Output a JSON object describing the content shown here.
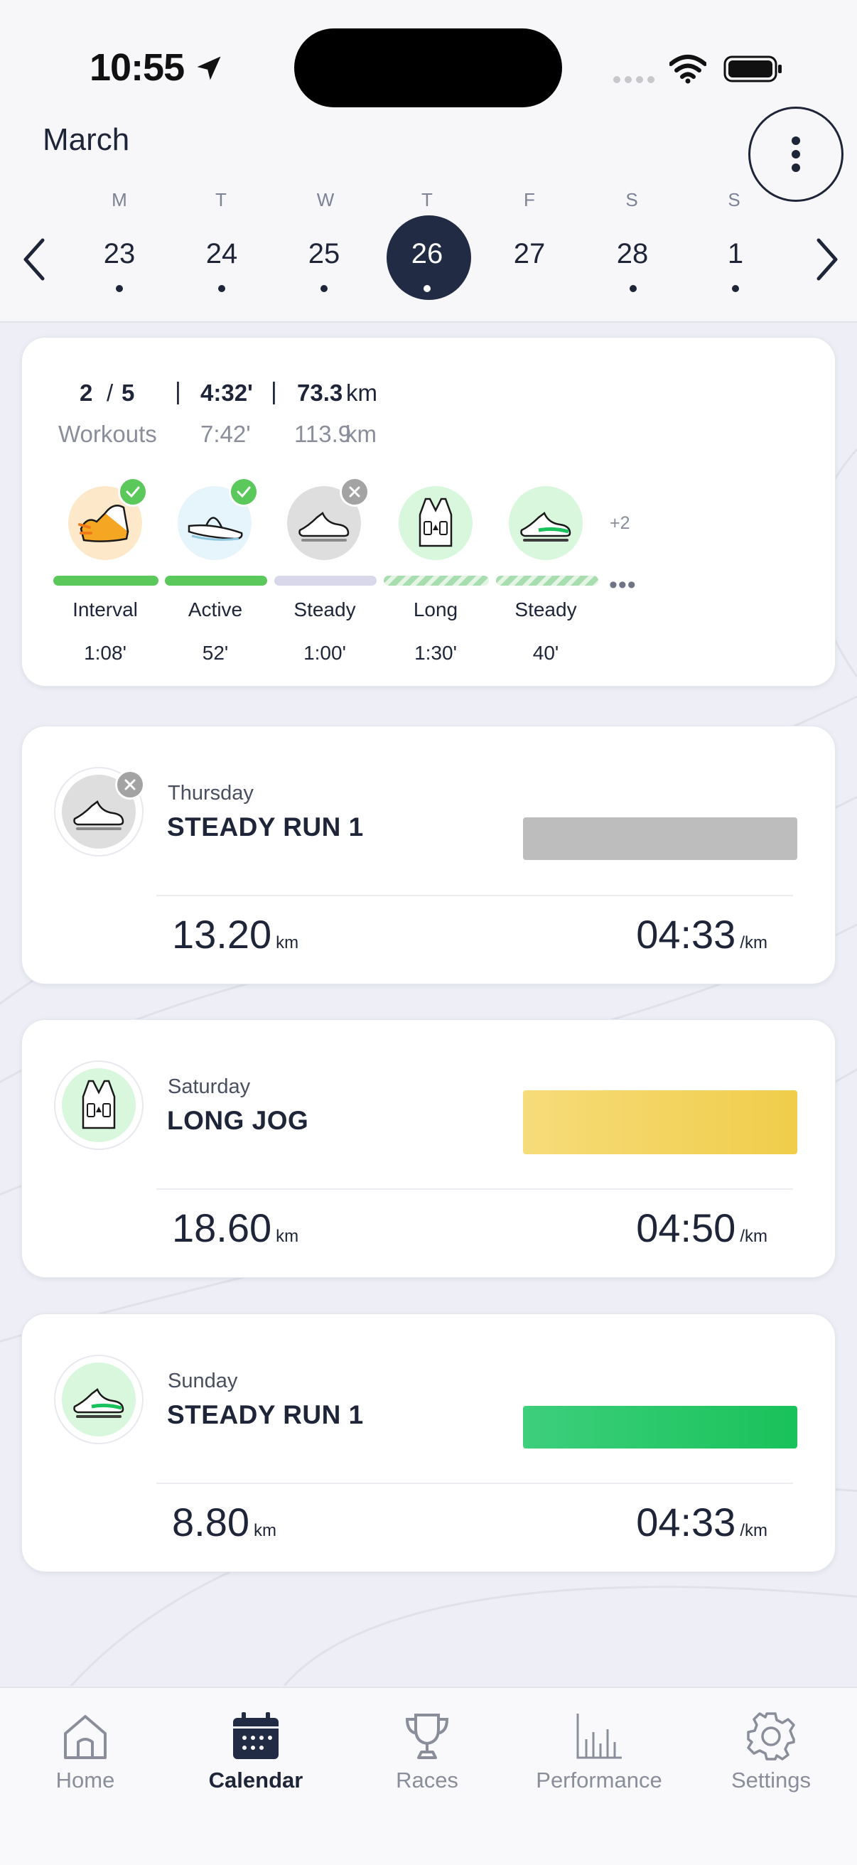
{
  "status_bar": {
    "time": "10:55"
  },
  "header": {
    "month": "March",
    "week": [
      {
        "weekday": "M",
        "day": "23",
        "has_dot": true
      },
      {
        "weekday": "T",
        "day": "24",
        "has_dot": true
      },
      {
        "weekday": "W",
        "day": "25",
        "has_dot": true
      },
      {
        "weekday": "T",
        "day": "26",
        "has_dot": true,
        "selected": true
      },
      {
        "weekday": "F",
        "day": "27",
        "has_dot": false
      },
      {
        "weekday": "S",
        "day": "28",
        "has_dot": true
      },
      {
        "weekday": "S",
        "day": "1",
        "has_dot": true
      }
    ]
  },
  "summary": {
    "workouts_done": "2",
    "workouts_total": "5",
    "time_done": "4:32'",
    "distance_done": "73.3",
    "distance_unit": "km",
    "workouts_label": "Workouts",
    "time_total": "7:42'",
    "distance_total": "113.9",
    "workouts": [
      {
        "label": "Interval",
        "duration": "1:08'",
        "status": "completed",
        "icon": "interval-shoe-icon"
      },
      {
        "label": "Active",
        "duration": "52'",
        "status": "completed",
        "icon": "sandal-icon"
      },
      {
        "label": "Steady",
        "duration": "1:00'",
        "status": "missed",
        "icon": "running-shoe-icon"
      },
      {
        "label": "Long",
        "duration": "1:30'",
        "status": "planned",
        "icon": "running-vest-icon"
      },
      {
        "label": "Steady",
        "duration": "40'",
        "status": "planned",
        "icon": "running-shoe-icon"
      }
    ],
    "more_count": "+2",
    "more_dots": "•••"
  },
  "workout_cards": [
    {
      "day": "Thursday",
      "title": "STEADY RUN 1",
      "distance": "13.20",
      "distance_unit": "km",
      "pace": "04:33",
      "pace_unit": "/km",
      "icon": "running-shoe-icon",
      "status": "missed"
    },
    {
      "day": "Saturday",
      "title": "LONG JOG",
      "distance": "18.60",
      "distance_unit": "km",
      "pace": "04:50",
      "pace_unit": "/km",
      "icon": "running-vest-icon",
      "status": "planned"
    },
    {
      "day": "Sunday",
      "title": "STEADY RUN 1",
      "distance": "8.80",
      "distance_unit": "km",
      "pace": "04:33",
      "pace_unit": "/km",
      "icon": "running-shoe-icon",
      "status": "planned"
    }
  ],
  "tabs": [
    {
      "label": "Home",
      "icon": "home-icon",
      "active": false
    },
    {
      "label": "Calendar",
      "icon": "calendar-icon",
      "active": true
    },
    {
      "label": "Races",
      "icon": "trophy-icon",
      "active": false
    },
    {
      "label": "Performance",
      "icon": "bar-chart-icon",
      "active": false
    },
    {
      "label": "Settings",
      "icon": "gear-icon",
      "active": false
    }
  ],
  "colors": {
    "navy": "#222b44",
    "completed_green": "#5ac85a",
    "missed_lavender": "#d8d8ea",
    "planned_hatch": "#a8ddb0",
    "missed_bar": "#bdbdbd",
    "long_bar": "#f0cd4a",
    "steady_bar": "#19c25a"
  }
}
